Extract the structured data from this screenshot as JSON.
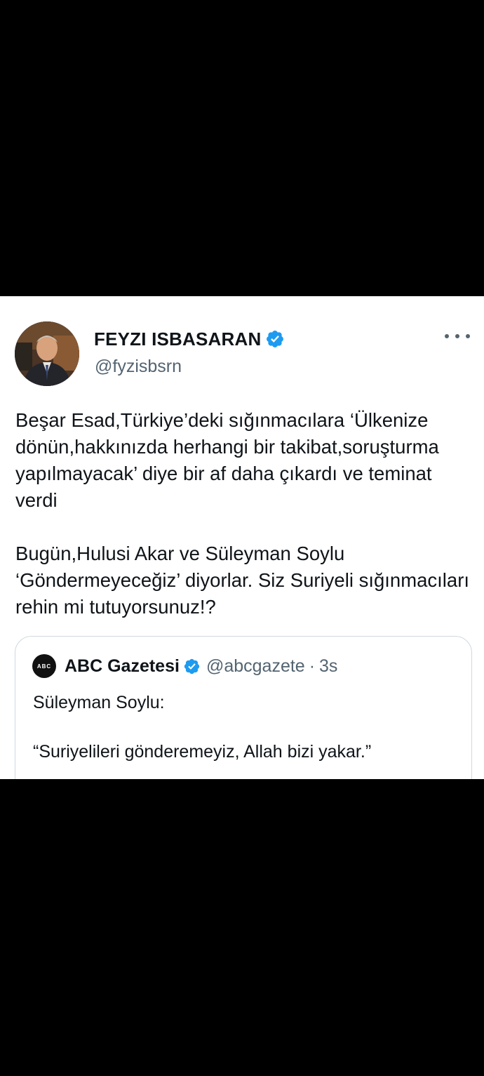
{
  "tweet": {
    "author_name": "FEYZI ISBASARAN",
    "author_handle": "@fyzisbsrn",
    "avatar_icon": "profile-photo",
    "more_icon": "more-horizontal-icon",
    "verified_color": "#1d9bf0",
    "text_paragraphs": [
      "Beşar Esad,Türkiye’deki sığınmacılara ‘Ülkenize dönün,hakkınızda herhangi bir takibat,soruşturma yapılmayacak’ diye bir af daha çıkardı ve teminat verdi",
      "Bugün,Hulusi Akar ve Süleyman Soylu ‘Göndermeyeceğiz’ diyorlar. Siz Suriyeli sığınmacıları rehin mi tutuyorsunuz!?"
    ]
  },
  "quoted_tweet": {
    "logo_text": "ABC",
    "author_name": "ABC Gazetesi",
    "author_handle": "@abcgazete",
    "separator": "·",
    "time": "3s",
    "text_paragraphs": [
      "Süleyman Soylu:",
      "“Suriyelileri gönderemeyiz, Allah bizi yakar.”"
    ]
  }
}
